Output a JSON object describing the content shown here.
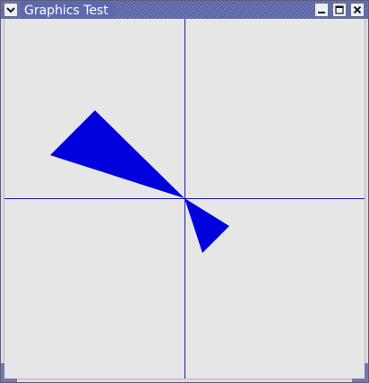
{
  "window": {
    "title": "Graphics Test",
    "controls": {
      "menu_icon": "chevron-down-icon",
      "minimize_icon": "minimize-icon",
      "maximize_icon": "maximize-icon",
      "close_icon": "close-icon"
    }
  },
  "colors": {
    "shape_fill": "#0000dc",
    "axis_line": "#1a1aa8",
    "canvas_background": "#e6e6e6",
    "titlebar": "#5a64a8"
  }
}
